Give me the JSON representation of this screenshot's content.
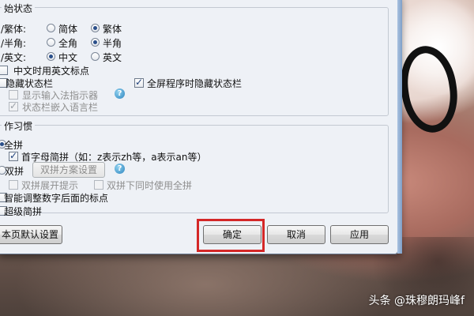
{
  "status_group": {
    "title": "始状态",
    "rows": [
      {
        "label": "/繁体:",
        "options": [
          "简体",
          "繁体"
        ],
        "selected": 1
      },
      {
        "label": "/半角:",
        "options": [
          "全角",
          "半角"
        ],
        "selected": 1
      },
      {
        "label": "/英文:",
        "options": [
          "中文",
          "英文"
        ],
        "selected": 0
      }
    ],
    "chinese_punct_label": "中文时用英文标点",
    "hide_statusbar_label": "隐藏状态栏",
    "fullscreen_hide_label": "全屏程序时隐藏状态栏",
    "show_indicator_label": "显示输入法指示器",
    "embed_langbar_label": "状态栏嵌入语言栏"
  },
  "habit_group": {
    "title": "作习惯",
    "quanpin_label": "全拼",
    "initial_abbrev_label": "首字母简拼（如：z表示zh等，a表示an等）",
    "shuangpin_label": "双拼",
    "shuangpin_scheme_button": "双拼方案设置",
    "shuangpin_expand_label": "双拼展开提示",
    "shuangpin_with_quanpin_label": "双拼下同时使用全拼",
    "smart_punct_label": "智能调整数字后面的标点",
    "super_abbrev_label": "超级简拼"
  },
  "buttons": {
    "defaults": "本页默认设置",
    "ok": "确定",
    "cancel": "取消",
    "apply": "应用"
  },
  "help_icon_glyph": "?",
  "watermark": "头条 @珠穆朗玛峰f",
  "colors": {
    "dialog_bg": "#eef1f6",
    "highlight": "#d42727"
  }
}
